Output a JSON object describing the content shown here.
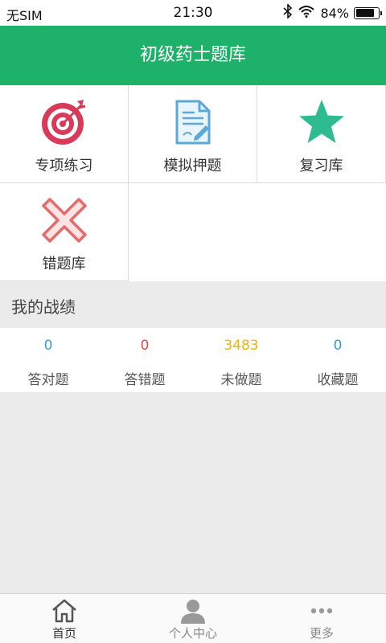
{
  "status_bar": {
    "carrier": "无SIM",
    "time": "21:30",
    "battery_text": "84%",
    "battery_level": 0.84
  },
  "header": {
    "title": "初级药士题库"
  },
  "menu": {
    "items": [
      {
        "label": "专项练习",
        "icon": "target-icon"
      },
      {
        "label": "模拟押题",
        "icon": "document-pen-icon"
      },
      {
        "label": "复习库",
        "icon": "star-icon"
      },
      {
        "label": "错题库",
        "icon": "cross-icon"
      }
    ]
  },
  "record": {
    "title": "我的战绩",
    "stats": [
      {
        "value": "0",
        "label": "答对题",
        "color": "#3a9bd2"
      },
      {
        "value": "0",
        "label": "答错题",
        "color": "#e04b4b"
      },
      {
        "value": "3483",
        "label": "未做题",
        "color": "#f0b400"
      },
      {
        "value": "0",
        "label": "收藏题",
        "color": "#3a9bd2"
      }
    ]
  },
  "tabbar": {
    "tabs": [
      {
        "label": "首页",
        "icon": "home-icon"
      },
      {
        "label": "个人中心",
        "icon": "person-icon"
      },
      {
        "label": "更多",
        "icon": "more-icon"
      }
    ]
  },
  "colors": {
    "brand_green": "#1db16a",
    "target_red": "#d83a5a",
    "doc_blue": "#5aa9d6",
    "star_green": "#2dbb8f",
    "cross_red": "#e86a6a"
  }
}
